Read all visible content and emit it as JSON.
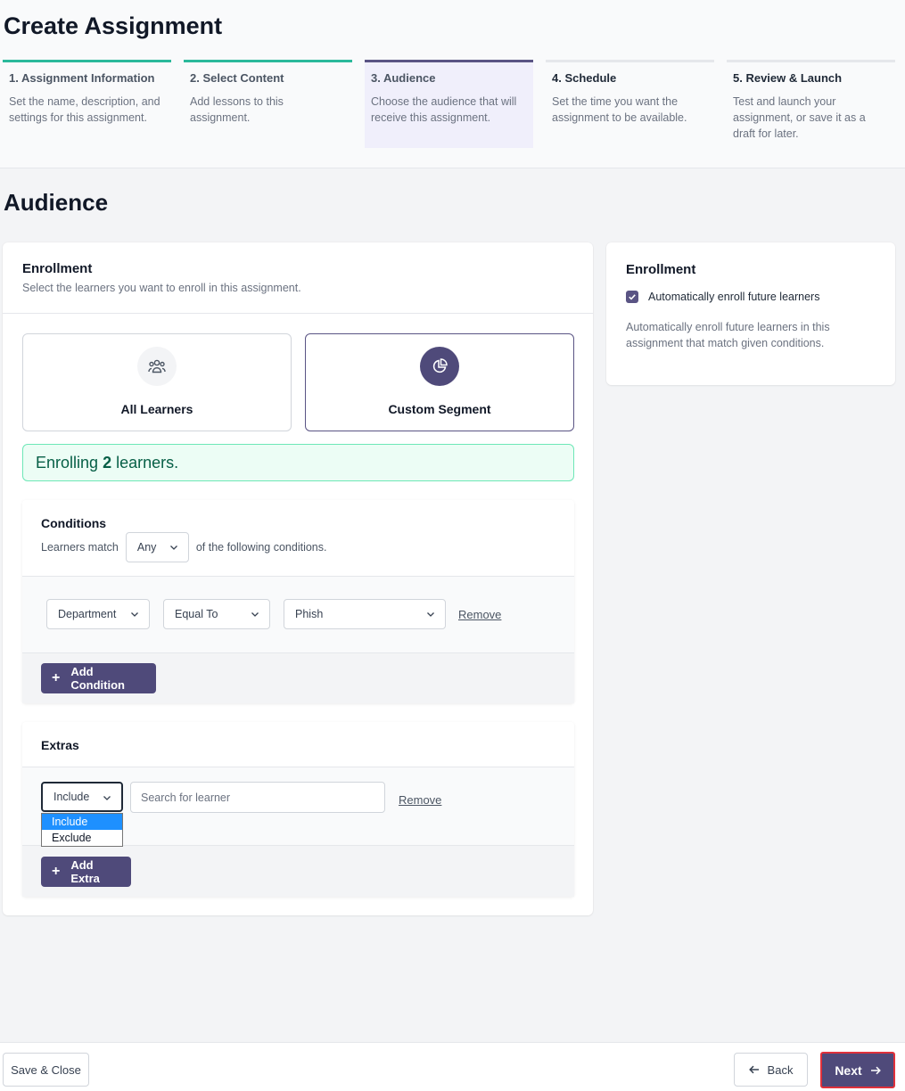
{
  "page": {
    "title": "Create Assignment",
    "section_title": "Audience"
  },
  "steps": [
    {
      "title": "1. Assignment Information",
      "desc": "Set the name, description, and settings for this assignment."
    },
    {
      "title": "2. Select Content",
      "desc": "Add lessons to this assignment."
    },
    {
      "title": "3. Audience",
      "desc": "Choose the audience that will receive this assignment."
    },
    {
      "title": "4. Schedule",
      "desc": "Set the time you want the assignment to be available."
    },
    {
      "title": "5. Review & Launch",
      "desc": "Test and launch your assignment, or save it as a draft for later."
    }
  ],
  "enrollment": {
    "title": "Enrollment",
    "subtitle": "Select the learners you want to enroll in this assignment.",
    "options": {
      "all": "All Learners",
      "custom": "Custom Segment"
    },
    "banner_prefix": "Enrolling",
    "banner_count": "2",
    "banner_suffix": "learners."
  },
  "conditions": {
    "title": "Conditions",
    "match_prefix": "Learners match",
    "match_value": "Any",
    "match_suffix": "of the following conditions.",
    "row": {
      "field": "Department",
      "operator": "Equal To",
      "value": "Phish",
      "remove": "Remove"
    },
    "add_label": "Add Condition"
  },
  "extras": {
    "title": "Extras",
    "mode": "Include",
    "search_placeholder": "Search for learner",
    "remove": "Remove",
    "dropdown_options": [
      "Include",
      "Exclude"
    ],
    "add_label": "Add Extra"
  },
  "side": {
    "title": "Enrollment",
    "checkbox_label": "Automatically enroll future learners",
    "description": "Automatically enroll future learners in this assignment that match given conditions."
  },
  "footer": {
    "save_close": "Save & Close",
    "back": "Back",
    "next": "Next"
  },
  "colors": {
    "primary": "#4f4a7a",
    "done": "#2bb99b",
    "success_bg": "#ecfdf5",
    "highlight": "#e0313b"
  }
}
